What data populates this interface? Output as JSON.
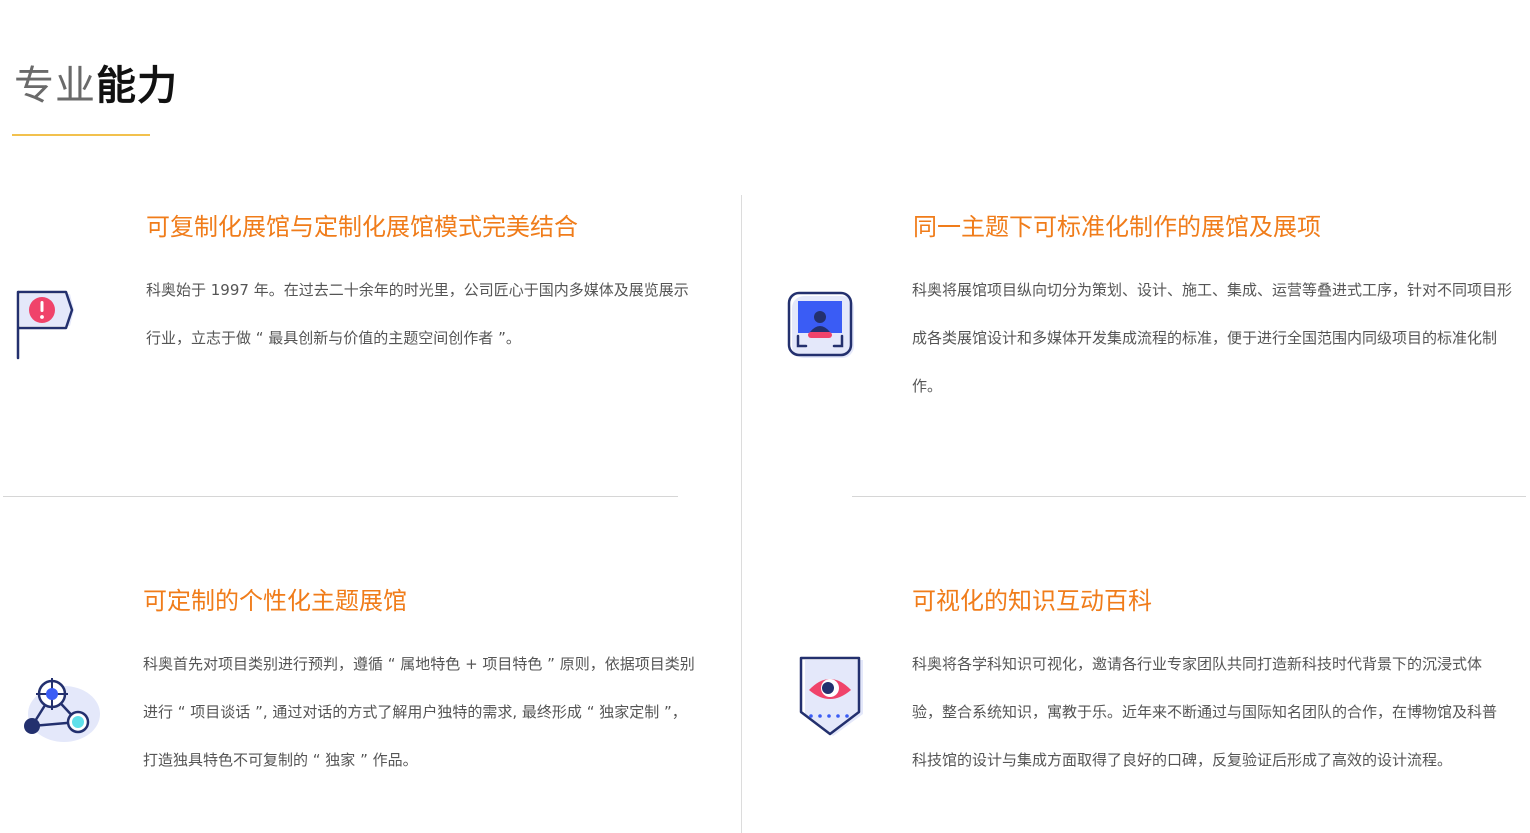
{
  "header": {
    "title_light": "专业",
    "title_bold": "能力"
  },
  "cards": [
    {
      "icon": "flag-alert-icon",
      "title": "可复制化展馆与定制化展馆模式完美结合",
      "body": "科奥始于 1997 年。在过去二十余年的时光里，公司匠心于国内多媒体及展览展示行业，立志于做 “ 最具创新与价值的主题空间创作者 ”。"
    },
    {
      "icon": "screen-scan-icon",
      "title": "同一主题下可标准化制作的展馆及展项",
      "body": "科奥将展馆项目纵向切分为策划、设计、施工、集成、运营等叠进式工序，针对不同项目形成各类展馆设计和多媒体开发集成流程的标准，便于进行全国范围内同级项目的标准化制作。"
    },
    {
      "icon": "target-connect-icon",
      "title": "可定制的个性化主题展馆",
      "body": "科奥首先对项目类别进行预判，遵循 “ 属地特色 + 项目特色 ” 原则，依据项目类别进行 “ 项目谈话 ”, 通过对话的方式了解用户独特的需求, 最终形成 “ 独家定制 ”，打造独具特色不可复制的 “ 独家 ” 作品。"
    },
    {
      "icon": "eye-shield-icon",
      "title": "可视化的知识互动百科",
      "body": "科奥将各学科知识可视化，邀请各行业专家团队共同打造新科技时代背景下的沉浸式体验，整合系统知识，寓教于乐。近年来不断通过与国际知名团队的合作，在博物馆及科普科技馆的设计与集成方面取得了良好的口碑，反复验证后形成了高效的设计流程。"
    }
  ],
  "colors": {
    "accent_orange": "#f07c1a",
    "underline_gold": "#f2c14e",
    "icon_navy": "#23306e",
    "icon_pink": "#f0436a",
    "icon_blue": "#3a5cf5",
    "icon_cyan": "#5fe0ea"
  }
}
